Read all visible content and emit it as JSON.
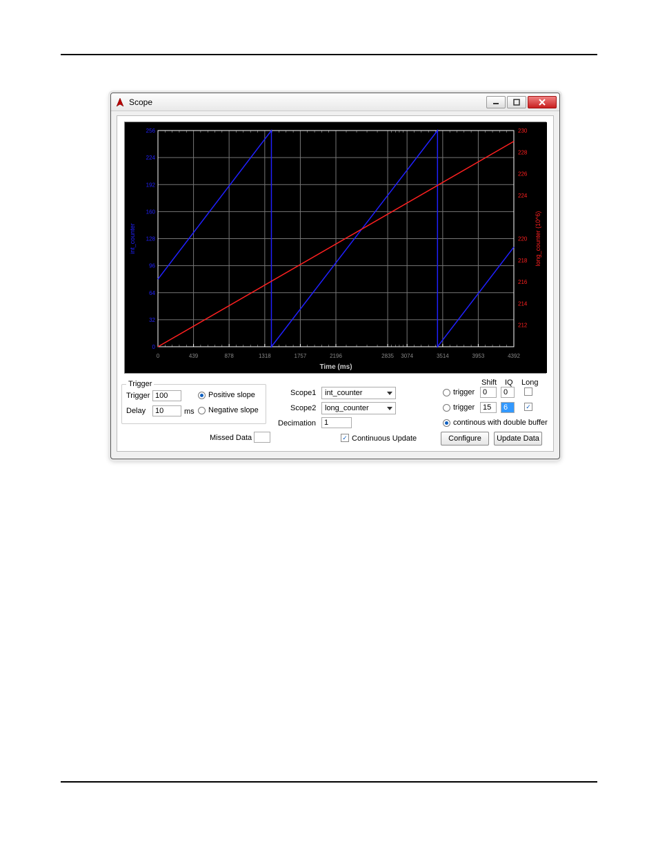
{
  "window": {
    "title": "Scope"
  },
  "chart": {
    "xaxis": {
      "label": "Time (ms)",
      "ticks": [
        0,
        439,
        878,
        1318,
        1757,
        2196,
        2835,
        3074,
        3514,
        3953,
        4392
      ]
    },
    "left_axis": {
      "label": "int_counter",
      "ticks": [
        0,
        32,
        64,
        96,
        128,
        160,
        192,
        224,
        256
      ],
      "color": "#2020ff"
    },
    "right_axis": {
      "label": "long_counter (10^6)",
      "ticks": [
        212,
        214,
        216,
        218,
        220,
        224,
        226,
        228,
        230
      ],
      "color": "#ff2020"
    }
  },
  "chart_data": {
    "type": "line",
    "x_range": [
      0,
      4392
    ],
    "xlabel": "Time (ms)",
    "series": [
      {
        "name": "int_counter",
        "y_axis": "left",
        "color": "#2020ff",
        "ylim": [
          0,
          256
        ],
        "points": [
          [
            0,
            80
          ],
          [
            1400,
            256
          ],
          [
            1400,
            0
          ],
          [
            3450,
            256
          ],
          [
            3450,
            0
          ],
          [
            4392,
            118
          ]
        ]
      },
      {
        "name": "long_counter (10^6)",
        "y_axis": "right",
        "color": "#ff2020",
        "ylim": [
          210,
          230
        ],
        "points": [
          [
            0,
            210
          ],
          [
            4392,
            229
          ]
        ]
      }
    ]
  },
  "trigger": {
    "legend": "Trigger",
    "trigger_label": "Trigger",
    "trigger_value": "100",
    "delay_label": "Delay",
    "delay_value": "10",
    "delay_unit": "ms",
    "pos_slope": "Positive slope",
    "neg_slope": "Negative slope"
  },
  "missed": {
    "label": "Missed Data",
    "value": ""
  },
  "scopes": {
    "scope1_label": "Scope1",
    "scope1_value": "int_counter",
    "scope2_label": "Scope2",
    "scope2_value": "long_counter",
    "decimation_label": "Decimation",
    "decimation_value": "1",
    "continuous_update": "Continuous Update"
  },
  "right": {
    "shift_header": "Shift",
    "iq_header": "IQ",
    "long_header": "Long",
    "trigger_label": "trigger",
    "row1": {
      "shift": "0",
      "iq": "0",
      "long_checked": false
    },
    "row2": {
      "shift": "15",
      "iq": "6",
      "long_checked": true
    },
    "continuous": "continous with double buffer"
  },
  "buttons": {
    "configure": "Configure",
    "update": "Update Data"
  }
}
